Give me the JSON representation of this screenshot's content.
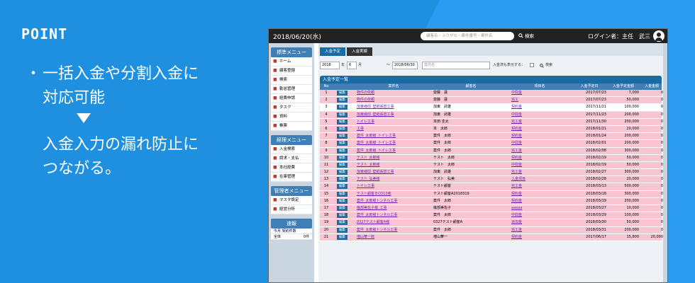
{
  "promo": {
    "point_label": "POINT",
    "bullet": "・",
    "lines": [
      "一括入金や分割入金に",
      "対応可能"
    ],
    "result_lines": [
      "入金入力の漏れ防止に",
      "つながる。"
    ]
  },
  "app": {
    "date": "2018/06/20(水)",
    "search_placeholder": "顧客名・ふりがな・案件番号・案件名",
    "search_label": "検索",
    "login_text": "ログイン者：主任　武三",
    "sidebar": {
      "standard_menu": {
        "title": "標準メニュー",
        "items": [
          {
            "label": "ホーム",
            "icon": "home-icon"
          },
          {
            "label": "顧客登録",
            "icon": "customer-icon"
          },
          {
            "label": "検索",
            "icon": "search-icon"
          },
          {
            "label": "勤怠管理",
            "icon": "clock-icon"
          },
          {
            "label": "経費申請",
            "icon": "expense-icon"
          },
          {
            "label": "タスク",
            "icon": "task-icon"
          },
          {
            "label": "資料",
            "icon": "document-icon"
          },
          {
            "label": "帳票",
            "icon": "report-icon"
          }
        ]
      },
      "accounting_menu": {
        "title": "経理メニュー",
        "items": [
          {
            "label": "入金検索",
            "icon": "deposit-icon"
          },
          {
            "label": "請求・支払",
            "icon": "invoice-icon"
          },
          {
            "label": "本社経費",
            "icon": "hq-expense-icon"
          },
          {
            "label": "在庫管理",
            "icon": "inventory-icon"
          }
        ]
      },
      "admin_menu": {
        "title": "管理者メニュー",
        "items": [
          {
            "label": "マスタ設定",
            "icon": "gear-icon"
          },
          {
            "label": "経営分析",
            "icon": "analysis-icon"
          }
        ]
      },
      "sokuho": {
        "title": "速報",
        "header": "今月 契約件数",
        "row_label": "全体",
        "row_value": "0件"
      }
    },
    "tabs": [
      "入金予定",
      "入金実績"
    ],
    "filter": {
      "from_date": "2018",
      "month_prefix": "年",
      "month_value": "6",
      "month_suffix": "月",
      "range_sep": "～",
      "to_date": "2018/06/30",
      "case_placeholder": "案件名",
      "show_paid_label": "入金済も表示する：",
      "search_label": "検索"
    },
    "list_title": "入金予定一覧",
    "columns": [
      "No",
      "",
      "案件名",
      "顧客名",
      "項目名",
      "入金予定日",
      "入金予定金額",
      "入金金額"
    ],
    "edit_label": "編集",
    "rows": [
      {
        "no": "1",
        "case": "物件の依頼",
        "customer": "齋藤　蓮",
        "item": "中間金",
        "date": "2017/07/23",
        "amount": "7,000",
        "paid": "0",
        "white": false
      },
      {
        "no": "2",
        "case": "物件の依頼",
        "customer": "齋藤　蓮",
        "item": "完工",
        "date": "2017/07/23",
        "amount": "50,000",
        "paid": "0",
        "white": false
      },
      {
        "no": "3",
        "case": "加東様邸_壁紙張替工事",
        "customer": "加東　武雄",
        "item": "契約金",
        "date": "2017/11/21",
        "amount": "100,000",
        "paid": "0",
        "white": true
      },
      {
        "no": "4",
        "case": "加東様邸_壁紙張替工事",
        "customer": "加東　武雄",
        "item": "中間金",
        "date": "2017/11/23",
        "amount": "200,000",
        "paid": "0",
        "white": false
      },
      {
        "no": "5",
        "case": "トイレ工事",
        "customer": "本田 圭太",
        "item": "完工金",
        "date": "2017/11/30",
        "amount": "200,000",
        "paid": "0",
        "white": false
      },
      {
        "no": "6",
        "case": "工事",
        "customer": "本　太郎",
        "item": "契約金",
        "date": "2018/01/21",
        "amount": "20,000",
        "paid": "0",
        "white": false
      },
      {
        "no": "7",
        "case": "案件_太郎様_トイレ工事",
        "customer": "案件　太郎",
        "item": "契約金",
        "date": "2018/01/24",
        "amount": "200,000",
        "paid": "0",
        "white": false
      },
      {
        "no": "8",
        "case": "案件_太郎様_トイレ工事",
        "customer": "案件　太郎",
        "item": "中間金",
        "date": "2018/02/01",
        "amount": "200,000",
        "paid": "0",
        "white": false
      },
      {
        "no": "9",
        "case": "案件_太郎様_トイレ工事",
        "customer": "案件　太郎",
        "item": "完工金",
        "date": "2018/02/08",
        "amount": "300,000",
        "paid": "0",
        "white": false
      },
      {
        "no": "10",
        "case": "テスト_太郎様",
        "customer": "テスト　太郎",
        "item": "契約金",
        "date": "2018/02/19",
        "amount": "50,000",
        "paid": "0",
        "white": false
      },
      {
        "no": "11",
        "case": "テスト_太郎様",
        "customer": "テスト　太郎",
        "item": "中間金",
        "date": "2018/02/19",
        "amount": "50,000",
        "paid": "0",
        "white": false
      },
      {
        "no": "12",
        "case": "加東様邸_壁紙張替工事",
        "customer": "加東　武雄",
        "item": "完工金",
        "date": "2018/02/27",
        "amount": "300,000",
        "paid": "0",
        "white": false
      },
      {
        "no": "13",
        "case": "テスト_弘美様",
        "customer": "テスト　弘美",
        "item": "入金項目",
        "date": "2018/02/28",
        "amount": "20,000",
        "paid": "0",
        "white": false
      },
      {
        "no": "14",
        "case": "トイレ工事",
        "customer": "テスト顧客",
        "item": "完工金",
        "date": "2018/03/13",
        "amount": "500,000",
        "paid": "0",
        "white": false
      },
      {
        "no": "15",
        "case": "テスト顧客ＢO313様",
        "customer": "テスト顧客A2018319",
        "item": "契約金",
        "date": "2018/03/18",
        "amount": "300,000",
        "paid": "0",
        "white": false
      },
      {
        "no": "16",
        "case": "案件_太郎様トンネル工事",
        "customer": "案件　太郎",
        "item": "契約金",
        "date": "2018/03/19",
        "amount": "200,000",
        "paid": "0",
        "white": false
      },
      {
        "no": "17",
        "case": "篠部美佐子様_工事",
        "customer": "篠部美佐子",
        "item": "aaaaa",
        "date": "2018/03/27",
        "amount": "10,000",
        "paid": "0",
        "white": false
      },
      {
        "no": "18",
        "case": "案件_太郎様トンネル工事",
        "customer": "案件　太郎",
        "item": "中間金",
        "date": "2018/03/29",
        "amount": "100,000",
        "paid": "0",
        "white": false
      },
      {
        "no": "19",
        "case": "0327テスト顧客A様",
        "customer": "0327テスト顧客A",
        "item": "追加金",
        "date": "2018/03/30",
        "amount": "50,000",
        "paid": "0",
        "white": false
      },
      {
        "no": "20",
        "case": "案件_太郎様トンネル工事",
        "customer": "案件　太郎",
        "item": "完工金",
        "date": "2018/03/31",
        "amount": "200,000",
        "paid": "0",
        "white": false
      },
      {
        "no": "21",
        "case": "増山華一郎",
        "customer": "増山華一",
        "item": "契約金",
        "date": "2017/06/17",
        "amount": "15,800",
        "paid": "20,000",
        "white": false
      }
    ]
  }
}
